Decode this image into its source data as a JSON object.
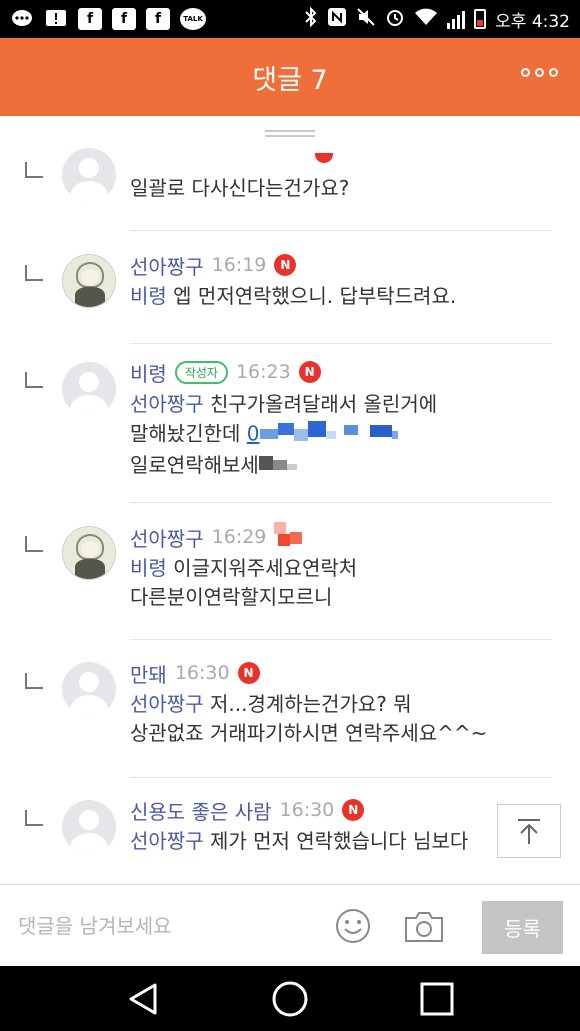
{
  "status_bar": {
    "left_icons": [
      "chat-icon",
      "alert-icon",
      "facebook-icon",
      "facebook-icon",
      "facebook-icon",
      "kakaotalk-icon"
    ],
    "talk_label": "TALK",
    "right_icons": [
      "bluetooth-icon",
      "nfc-icon",
      "mute-icon",
      "alarm-icon",
      "wifi-icon",
      "signal-icon",
      "battery-icon"
    ],
    "time": "오후 4:32"
  },
  "header": {
    "title": "댓글 7"
  },
  "comments": [
    {
      "author": "",
      "badge": "",
      "time": "",
      "is_new": true,
      "mention": "",
      "lines": [
        "일괄로 다사신다는건가요?"
      ]
    },
    {
      "author": "선아짱구",
      "time": "16:19",
      "is_new": true,
      "new_label": "N",
      "mention": "비령",
      "lines": [
        "엡 먼저연락했으니. 답부탁드려요."
      ]
    },
    {
      "author": "비령",
      "badge": "작성자",
      "time": "16:23",
      "is_new": true,
      "new_label": "N",
      "mention": "선아짱구",
      "lines": [
        "친구가올려달래서 올린거에",
        "말해놨긴한데",
        "0",
        "일로연락해보세"
      ]
    },
    {
      "author": "선아짱구",
      "time": "16:29",
      "is_new": true,
      "mention": "비령",
      "lines": [
        "이글지워주세요연락처",
        "다른분이연락할지모르니"
      ]
    },
    {
      "author": "만돼",
      "time": "16:30",
      "is_new": true,
      "new_label": "N",
      "mention": "선아짱구",
      "lines": [
        "저...경계하는건가요? 뭐",
        "상관없죠 거래파기하시면 연락주세요^^~"
      ]
    },
    {
      "author": "신용도 좋은 사람",
      "time": "16:30",
      "is_new": true,
      "new_label": "N",
      "mention": "선아짱구",
      "lines": [
        "제가 먼저 연락했습니다 님보다"
      ]
    }
  ],
  "input_bar": {
    "placeholder": "댓글을 남겨보세요",
    "submit_label": "등록"
  },
  "colors": {
    "header": "#ef6f3a",
    "author_name": "#4a5aa8",
    "badge_green": "#3fbf6b",
    "new_red": "#e8322b"
  }
}
